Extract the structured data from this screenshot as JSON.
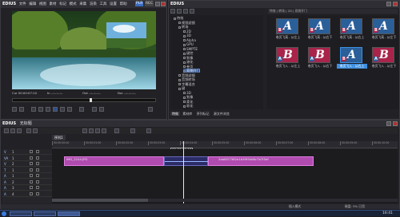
{
  "player": {
    "title": "EDIUS",
    "menu": [
      "文件",
      "编辑",
      "视图",
      "素材",
      "标记",
      "模式",
      "采集",
      "渲染",
      "工具",
      "设置",
      "帮助"
    ],
    "mode_badge": "PLR",
    "rec_badge": "REC",
    "timecodes": {
      "cur": "Cur 00:00:07:10",
      "in": "In --:--:--:--",
      "out": "Out --:--:--:--",
      "dur": "Dur --:--:--:--"
    }
  },
  "effects": {
    "title": "EDIUS",
    "path_text": "特效 | 转场 | 2D | 双侧开门",
    "tree": [
      {
        "label": "特效",
        "level": 0
      },
      {
        "label": "视频滤镜",
        "level": 1
      },
      {
        "label": "转场",
        "level": 1
      },
      {
        "label": "2D",
        "level": 2
      },
      {
        "label": "3D",
        "level": 2
      },
      {
        "label": "Alpha",
        "level": 2
      },
      {
        "label": "GPU",
        "level": 2
      },
      {
        "label": "SMPTE",
        "level": 2
      },
      {
        "label": "键控",
        "level": 2
      },
      {
        "label": "划像",
        "level": 2
      },
      {
        "label": "溶化",
        "level": 2
      },
      {
        "label": "卷页",
        "level": 2
      },
      {
        "label": "双侧开门",
        "level": 2,
        "selected": true
      },
      {
        "label": "音频滤镜",
        "level": 1
      },
      {
        "label": "音频转场",
        "level": 1
      },
      {
        "label": "字幕混合",
        "level": 1
      },
      {
        "label": "键",
        "level": 1
      },
      {
        "label": "3D",
        "level": 2
      },
      {
        "label": "划像",
        "level": 2
      },
      {
        "label": "柔化",
        "level": 2
      },
      {
        "label": "软化",
        "level": 2
      }
    ],
    "tabs": [
      "特效",
      "素材库",
      "序列标记",
      "源文件浏览"
    ],
    "tiles": [
      {
        "letter": "A",
        "sub": "B",
        "label": "卷页飞离 - 从左上"
      },
      {
        "letter": "A",
        "sub": "B",
        "label": "卷页飞离 - 从右下"
      },
      {
        "letter": "A",
        "sub": "B",
        "label": "卷页飞离 - 从右上"
      },
      {
        "letter": "A",
        "sub": "B",
        "label": "卷页飞离 - 从左下"
      },
      {
        "letter": "B",
        "sub": "A",
        "label": "卷页飞入 - 从左上"
      },
      {
        "letter": "B",
        "sub": "A",
        "label": "卷页飞入 - 从右下"
      },
      {
        "letter": "A",
        "sub": "B",
        "label": "卷页飞入 - 从右上",
        "selected": true
      },
      {
        "letter": "B",
        "sub": "A",
        "label": "卷页飞入 - 从左下"
      }
    ],
    "colors": {
      "tile_a": "#2a5f9a",
      "tile_b": "#a8244a",
      "selected": "#3e8fe0"
    }
  },
  "timeline": {
    "title": "EDIUS",
    "project": "无标题",
    "sequence_tab": "序列1",
    "cursor_tc": "00:00:06:15",
    "ruler_ticks": [
      "00:00:00:00",
      "00:00:01:00",
      "00:00:02:00",
      "00:00:03:00",
      "00:00:04:00",
      "00:00:05:00",
      "00:00:06:00",
      "00:00:07:00",
      "00:00:08:00",
      "00:00:09:00",
      "00:00:10:00"
    ],
    "tracks": [
      {
        "id": "1",
        "type": "V"
      },
      {
        "id": "1",
        "type": "VA"
      },
      {
        "id": "2",
        "type": "V"
      },
      {
        "id": "1",
        "type": "T"
      },
      {
        "id": "1",
        "type": "A"
      },
      {
        "id": "2",
        "type": "A"
      },
      {
        "id": "3",
        "type": "A"
      },
      {
        "id": "4",
        "type": "A"
      }
    ],
    "clip1_label": "IMG_2244.JPG",
    "clip2_label": "2ab6f27362e1b3f994d6c7b7f5ef",
    "status": "插入模式",
    "status_right": "磁盘: 5% 已用"
  },
  "taskbar": {
    "time": "16:41"
  }
}
